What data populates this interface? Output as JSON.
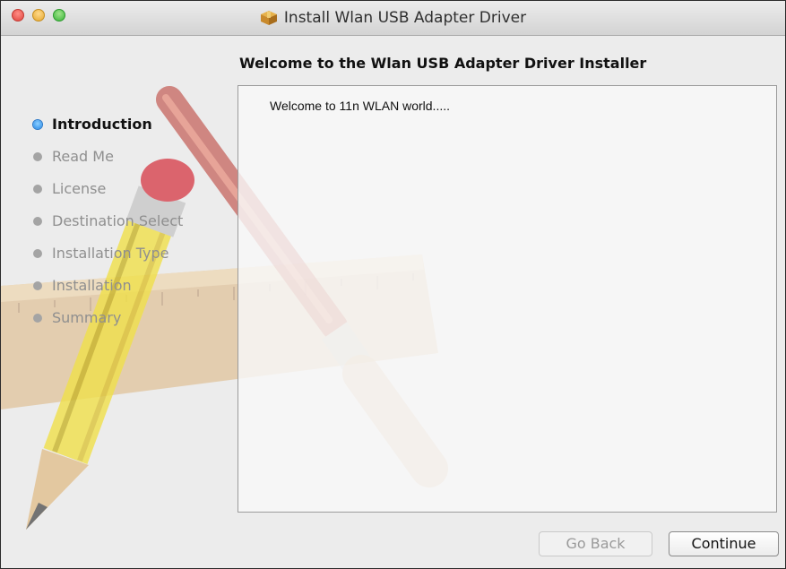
{
  "window": {
    "title": "Install Wlan USB Adapter Driver",
    "icon": "package-icon"
  },
  "header": {
    "title": "Welcome to the Wlan USB Adapter Driver Installer"
  },
  "steps": [
    {
      "label": "Introduction",
      "active": true
    },
    {
      "label": "Read Me",
      "active": false
    },
    {
      "label": "License",
      "active": false
    },
    {
      "label": "Destination Select",
      "active": false
    },
    {
      "label": "Installation Type",
      "active": false
    },
    {
      "label": "Installation",
      "active": false
    },
    {
      "label": "Summary",
      "active": false
    }
  ],
  "content": {
    "text": "Welcome to 11n WLAN world....."
  },
  "buttons": {
    "back_label": "Go Back",
    "back_enabled": false,
    "continue_label": "Continue"
  },
  "colors": {
    "active_step_bullet": "#1e86e8",
    "window_background": "#ececec"
  }
}
